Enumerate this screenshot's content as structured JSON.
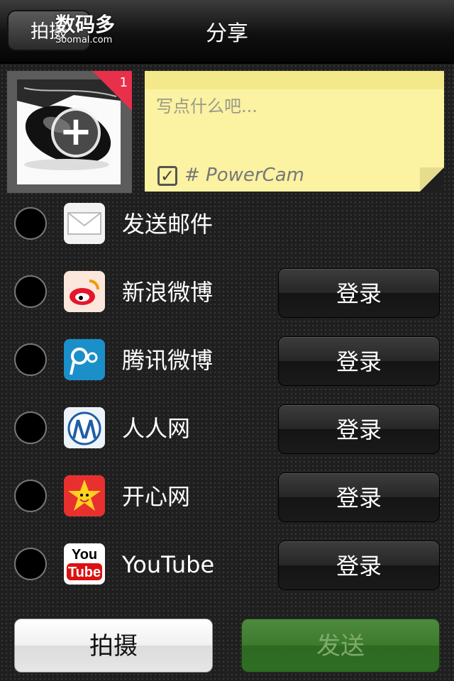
{
  "navbar": {
    "back_label": "拍摄",
    "title": "分享",
    "watermark": "数码多",
    "watermark_sub": "Soomal.com"
  },
  "photo": {
    "badge_count": "1"
  },
  "note": {
    "placeholder": "写点什么吧...",
    "tag_checked": true,
    "tag": "# PowerCam"
  },
  "services": [
    {
      "label": "发送邮件",
      "icon": "mail-icon",
      "login": ""
    },
    {
      "label": "新浪微博",
      "icon": "sina-weibo-icon",
      "login": "登录"
    },
    {
      "label": "腾讯微博",
      "icon": "tencent-weibo-icon",
      "login": "登录"
    },
    {
      "label": "人人网",
      "icon": "renren-icon",
      "login": "登录"
    },
    {
      "label": "开心网",
      "icon": "kaixin-icon",
      "login": "登录"
    },
    {
      "label": "YouTube",
      "icon": "youtube-icon",
      "login": "登录"
    }
  ],
  "footer": {
    "shoot_label": "拍摄",
    "send_label": "发送"
  },
  "colors": {
    "badge": "#e8304a",
    "note": "#fbf2a2",
    "send_button": "#3c7a2d"
  }
}
